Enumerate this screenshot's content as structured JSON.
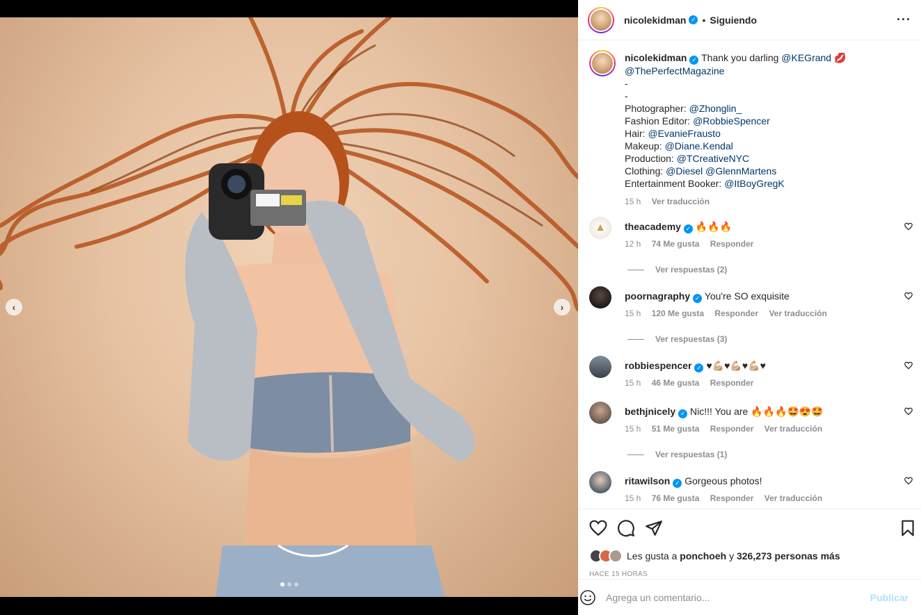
{
  "post": {
    "username": "nicolekidman",
    "separator": "•",
    "follow_status": "Siguiendo",
    "more_icon": "more-horizontal-icon"
  },
  "caption": {
    "lines": [
      "Thank you darling @KEGrand 💋",
      "@ThePerfectMagazine",
      "-",
      "-",
      "Photographer: @Zhonglin_",
      "Fashion Editor: @RobbieSpencer",
      "Hair: @EvanieFrausto",
      "Makeup: @Diane.Kendal",
      "Production: @TCreativeNYC",
      "Clothing: @Diesel @GlennMartens",
      "Entertainment Booker: @ItBoyGregK"
    ],
    "time": "15 h",
    "translate": "Ver traducción"
  },
  "comments": [
    {
      "user": "theacademy",
      "text": "🔥🔥🔥",
      "time": "12 h",
      "likes": "74 Me gusta",
      "reply": "Responder",
      "translate": "",
      "replies": "Ver respuestas (2)"
    },
    {
      "user": "poornagraphy",
      "text": "You're SO exquisite",
      "time": "15 h",
      "likes": "120 Me gusta",
      "reply": "Responder",
      "translate": "Ver traducción",
      "replies": "Ver respuestas (3)"
    },
    {
      "user": "robbiespencer",
      "text": "♥💪🏼♥💪🏼♥💪🏼♥",
      "time": "15 h",
      "likes": "46 Me gusta",
      "reply": "Responder",
      "translate": "",
      "replies": ""
    },
    {
      "user": "bethjnicely",
      "text": "Nic!!! You are 🔥🔥🔥🤩😍🤩",
      "time": "15 h",
      "likes": "51 Me gusta",
      "reply": "Responder",
      "translate": "Ver traducción",
      "replies": "Ver respuestas (1)"
    },
    {
      "user": "ritawilson",
      "text": "Gorgeous photos!",
      "time": "15 h",
      "likes": "76 Me gusta",
      "reply": "Responder",
      "translate": "Ver traducción",
      "replies": ""
    }
  ],
  "likes": {
    "prefix": "Les gusta a",
    "user": "ponchoeh",
    "middle": "y",
    "count": "326,273 personas más"
  },
  "timestamp": "HACE 15 HORAS",
  "composer": {
    "placeholder": "Agrega un comentario...",
    "publish": "Publicar"
  },
  "carousel": {
    "slide_count": 3,
    "active_index": 0
  },
  "colors": {
    "accent": "#0095f6",
    "link": "#00376b",
    "muted": "#8e8e8e",
    "publish_disabled": "#b2dffc"
  }
}
